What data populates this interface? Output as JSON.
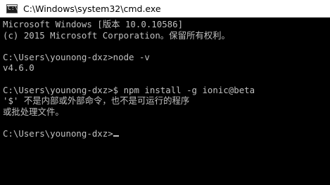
{
  "window": {
    "title": "C:\\Windows\\system32\\cmd.exe",
    "icon": "cmd-icon",
    "icon_glyph": "C:\\"
  },
  "console": {
    "lines": [
      "Microsoft Windows [版本 10.0.10586]",
      "(c) 2015 Microsoft Corporation。保留所有权利。",
      "",
      "C:\\Users\\younong-dxz>node -v",
      "v4.6.0",
      "",
      "C:\\Users\\younong-dxz>$ npm install -g ionic@beta",
      "'$' 不是内部或外部命令，也不是可运行的程序",
      "或批处理文件。",
      "",
      "C:\\Users\\younong-dxz>"
    ],
    "text_color": "#c0c0c0",
    "background": "#000000"
  }
}
